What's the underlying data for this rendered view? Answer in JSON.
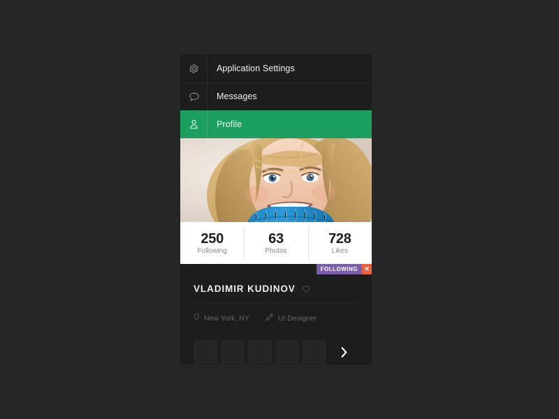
{
  "colors": {
    "page_background": "#262626",
    "card_background": "#1d1d1d",
    "accent_green": "#1a9e5e",
    "badge_purple": "#7b5ea8",
    "badge_close_orange": "#e8603c",
    "stats_background": "#ffffff"
  },
  "menu": {
    "items": [
      {
        "label": "Application Settings",
        "icon": "gear-icon",
        "active": false
      },
      {
        "label": "Messages",
        "icon": "speech-bubble-icon",
        "active": false
      },
      {
        "label": "Profile",
        "icon": "user-icon",
        "active": true
      }
    ]
  },
  "photo": {
    "alt": "Profile photo of smiling blonde woman wearing a blue knit turtleneck"
  },
  "stats": [
    {
      "value": "250",
      "label": "Following"
    },
    {
      "value": "63",
      "label": "Photos"
    },
    {
      "value": "728",
      "label": "Likes"
    }
  ],
  "follow_badge": {
    "label": "FOLLOWING",
    "close_label": "✕"
  },
  "profile": {
    "name": "VLADIMIR KUDINOV",
    "favorite_icon": "heart-icon",
    "meta": [
      {
        "icon": "location-pin-icon",
        "text": "New York, NY"
      },
      {
        "icon": "pen-tool-icon",
        "text": "UI Designer"
      }
    ]
  },
  "gallery": {
    "thumbnails": [
      "",
      "",
      "",
      "",
      ""
    ],
    "next_label": "›"
  }
}
